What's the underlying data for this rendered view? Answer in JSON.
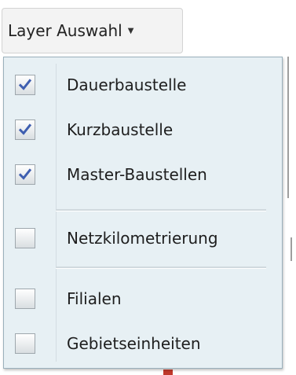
{
  "layer_button": {
    "label": "Layer Auswahl"
  },
  "layers_menu": {
    "groups": [
      [
        {
          "label": "Dauerbaustelle",
          "checked": true
        },
        {
          "label": "Kurzbaustelle",
          "checked": true
        },
        {
          "label": "Master-Baustellen",
          "checked": true
        }
      ],
      [
        {
          "label": "Netzkilometrierung",
          "checked": false
        }
      ],
      [
        {
          "label": "Filialen",
          "checked": false
        },
        {
          "label": "Gebietseinheiten",
          "checked": false
        }
      ]
    ]
  },
  "colors": {
    "panel_background": "#e7f0f4",
    "checkmark": "#3f5fb0"
  }
}
